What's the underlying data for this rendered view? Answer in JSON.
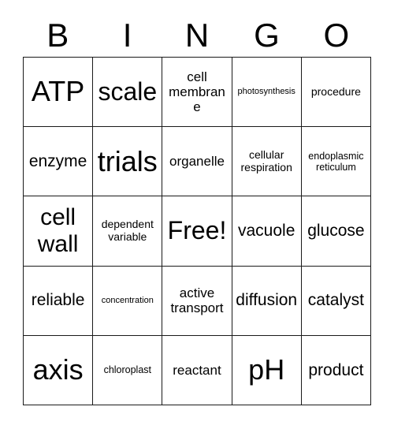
{
  "card": {
    "title": "BINGO",
    "header_letters": [
      "B",
      "I",
      "N",
      "G",
      "O"
    ],
    "columns": 5,
    "rows": 5,
    "free_space": "Free!",
    "free_space_position": "center",
    "colors": {
      "background": "#ffffff",
      "text": "#000000",
      "border": "#1a1a1a"
    },
    "rows_data": [
      [
        {
          "label": "ATP",
          "size": "fs-xxl"
        },
        {
          "label": "scale",
          "size": "fs-xl"
        },
        {
          "label": "cell membrane",
          "size": "fs-sm"
        },
        {
          "label": "photosynthesis",
          "size": "fs-tiny"
        },
        {
          "label": "procedure",
          "size": "fs-xs"
        }
      ],
      [
        {
          "label": "enzyme",
          "size": "fs-md"
        },
        {
          "label": "trials",
          "size": "fs-xxl"
        },
        {
          "label": "organelle",
          "size": "fs-sm"
        },
        {
          "label": "cellular respiration",
          "size": "fs-xs"
        },
        {
          "label": "endoplasmic reticulum",
          "size": "fs-xxs"
        }
      ],
      [
        {
          "label": "cell wall",
          "size": "fs-lg"
        },
        {
          "label": "dependent variable",
          "size": "fs-xs"
        },
        {
          "label": "Free!",
          "size": "fs-xl"
        },
        {
          "label": "vacuole",
          "size": "fs-md"
        },
        {
          "label": "glucose",
          "size": "fs-md"
        }
      ],
      [
        {
          "label": "reliable",
          "size": "fs-md"
        },
        {
          "label": "concentration",
          "size": "fs-tiny"
        },
        {
          "label": "active transport",
          "size": "fs-sm"
        },
        {
          "label": "diffusion",
          "size": "fs-md"
        },
        {
          "label": "catalyst",
          "size": "fs-md"
        }
      ],
      [
        {
          "label": "axis",
          "size": "fs-xxl"
        },
        {
          "label": "chloroplast",
          "size": "fs-xxs"
        },
        {
          "label": "reactant",
          "size": "fs-sm"
        },
        {
          "label": "pH",
          "size": "fs-xxl"
        },
        {
          "label": "product",
          "size": "fs-md"
        }
      ]
    ]
  }
}
